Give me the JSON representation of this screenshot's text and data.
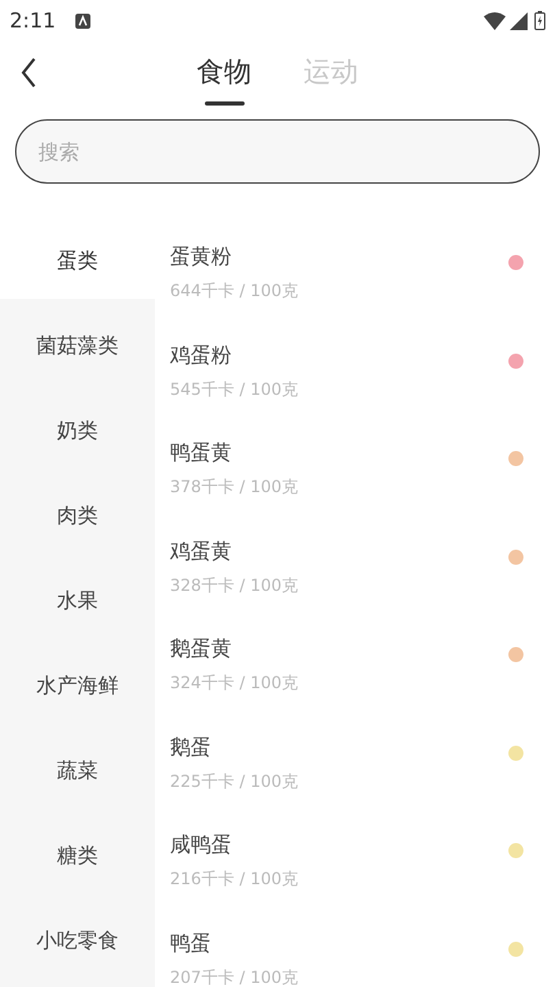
{
  "status_bar": {
    "time": "2:11"
  },
  "tabs": [
    {
      "label": "食物",
      "selected": true
    },
    {
      "label": "运动",
      "selected": false
    }
  ],
  "search": {
    "placeholder": "搜索"
  },
  "categories": [
    {
      "label": "蛋类",
      "selected": true
    },
    {
      "label": "菌菇藻类",
      "selected": false
    },
    {
      "label": "奶类",
      "selected": false
    },
    {
      "label": "肉类",
      "selected": false
    },
    {
      "label": "水果",
      "selected": false
    },
    {
      "label": "水产海鲜",
      "selected": false
    },
    {
      "label": "蔬菜",
      "selected": false
    },
    {
      "label": "糖类",
      "selected": false
    },
    {
      "label": "小吃零食",
      "selected": false
    }
  ],
  "foods": [
    {
      "name": "蛋黄粉",
      "energy": "644千卡 / 100克",
      "color": "#f4a3ae"
    },
    {
      "name": "鸡蛋粉",
      "energy": "545千卡 / 100克",
      "color": "#f4a3ae"
    },
    {
      "name": "鸭蛋黄",
      "energy": "378千卡 / 100克",
      "color": "#f3c5a2"
    },
    {
      "name": "鸡蛋黄",
      "energy": "328千卡 / 100克",
      "color": "#f3c5a2"
    },
    {
      "name": "鹅蛋黄",
      "energy": "324千卡 / 100克",
      "color": "#f3c5a2"
    },
    {
      "name": "鹅蛋",
      "energy": "225千卡 / 100克",
      "color": "#f3e4a2"
    },
    {
      "name": "咸鸭蛋",
      "energy": "216千卡 / 100克",
      "color": "#f3e4a2"
    },
    {
      "name": "鸭蛋",
      "energy": "207千卡 / 100克",
      "color": "#f3e4a2"
    }
  ]
}
